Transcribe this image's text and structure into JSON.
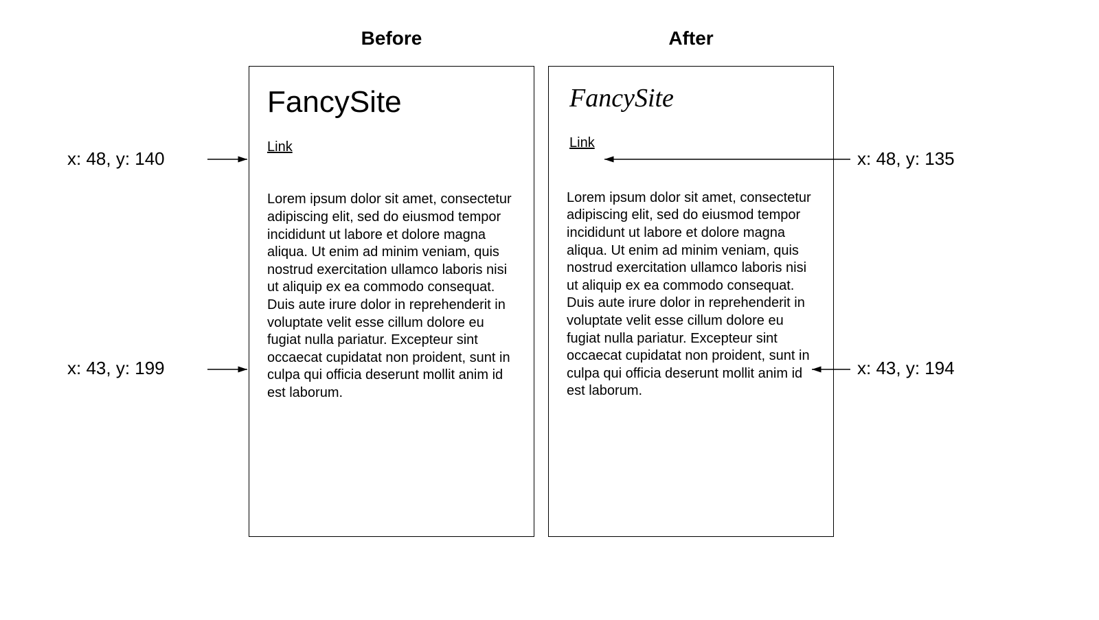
{
  "headers": {
    "before": "Before",
    "after": "After"
  },
  "site_title": "FancySite",
  "link_label": "Link",
  "body_text": "Lorem ipsum dolor sit amet, consectetur adipiscing elit, sed do eiusmod tempor incididunt ut labore et dolore magna aliqua. Ut enim ad minim veniam, quis nostrud exercitation ullamco laboris nisi ut aliquip ex ea commodo consequat. Duis aute irure dolor in reprehenderit in voluptate velit esse cillum dolore eu fugiat nulla pariatur. Excepteur sint occaecat cupidatat non proident, sunt in culpa qui officia deserunt mollit anim id est laborum.",
  "annotations": {
    "before_link": "x: 48, y: 140",
    "before_body": "x: 43, y: 199",
    "after_link": "x: 48, y: 135",
    "after_body": "x: 43, y: 194"
  }
}
